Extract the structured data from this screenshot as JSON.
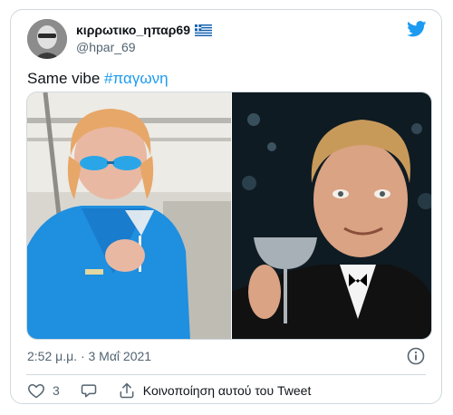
{
  "tweet": {
    "display_name": "κιρρωτικο_ηπαρ69",
    "handle": "@hpar_69",
    "text": "Same vibe ",
    "hashtag": "#παγωνη",
    "timestamp": "2:52 μ.μ. · 3 Μαΐ 2021",
    "like_count": "3",
    "share_label": "Κοινοποίηση αυτού του Tweet"
  },
  "icons": {
    "brand": "twitter-bird-icon",
    "flag": "greek-flag-icon",
    "info": "info-icon",
    "like": "heart-icon",
    "reply": "reply-bubble-icon",
    "share": "share-icon"
  },
  "colors": {
    "accent": "#1d9bf0",
    "text": "#0f1419",
    "muted": "#536471",
    "border": "#cfd9de"
  }
}
